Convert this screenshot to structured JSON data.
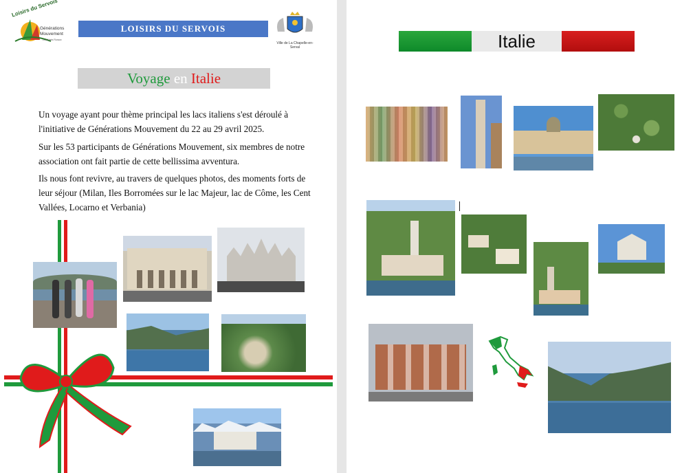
{
  "left_page": {
    "logo_left": {
      "text_top": "Loisirs du Servois",
      "text_side": "Générations Mouvement",
      "text_small": "Les Aînés Ruraux"
    },
    "banner": "LOISIRS DU SERVOIS",
    "logo_right": {
      "text": "Ville de La Chapelle-en-Serval"
    },
    "title": {
      "word1": "Voyage",
      "word2": "en",
      "word3": "Italie"
    },
    "paragraphs": [
      "Un voyage ayant pour thème principal les lacs italiens s'est déroulé à l'initiative de Générations Mouvement du 22 au 29 avril 2025.",
      "Sur les 53 participants de Générations Mouvement, six membres de notre association ont fait partie de cette bellissima avventura.",
      "Ils nous font revivre, au travers de quelques photos, des moments forts de leur séjour (Milan, Iles Borromées sur le lac Majeur, lac de Côme, les Cent Vallées, Locarno et Verbania)"
    ]
  },
  "right_page": {
    "header": "Italie"
  },
  "colors": {
    "italy_green": "#1f9a3c",
    "italy_white": "#ffffff",
    "italy_red": "#e01b1b",
    "banner_blue": "#4a77c7",
    "title_box": "#d3d3d3"
  }
}
